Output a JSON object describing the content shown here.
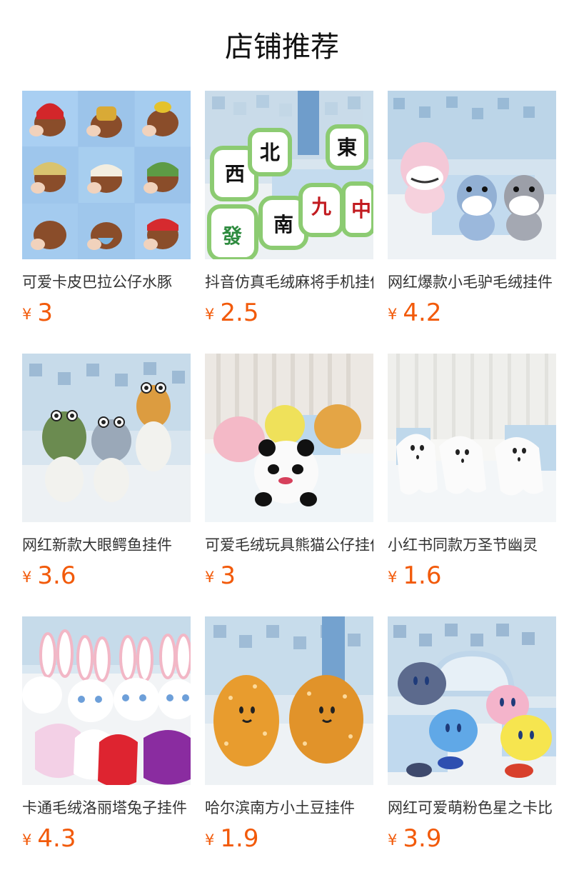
{
  "header": {
    "title": "店铺推荐"
  },
  "accent_color": "#f25a0a",
  "products": [
    {
      "name": "可爱卡皮巴拉公仔水豚",
      "currency": "¥",
      "price": "3",
      "image_icon": "capybara-plush-grid-image"
    },
    {
      "name": "抖音仿真毛绒麻将手机挂件",
      "currency": "¥",
      "price": "2.5",
      "image_icon": "mahjong-plush-image"
    },
    {
      "name": "网红爆款小毛驴毛绒挂件",
      "currency": "¥",
      "price": "4.2",
      "image_icon": "donkey-plush-image"
    },
    {
      "name": "网红新款大眼鳄鱼挂件",
      "currency": "¥",
      "price": "3.6",
      "image_icon": "crocodile-plush-image"
    },
    {
      "name": "可爱毛绒玩具熊猫公仔挂件",
      "currency": "¥",
      "price": "3",
      "image_icon": "panda-plush-image"
    },
    {
      "name": "小红书同款万圣节幽灵",
      "currency": "¥",
      "price": "1.6",
      "image_icon": "ghost-plush-image"
    },
    {
      "name": "卡通毛绒洛丽塔兔子挂件",
      "currency": "¥",
      "price": "4.3",
      "image_icon": "rabbit-plush-image"
    },
    {
      "name": "哈尔滨南方小土豆挂件",
      "currency": "¥",
      "price": "1.9",
      "image_icon": "potato-plush-image"
    },
    {
      "name": "网红可爱萌粉色星之卡比",
      "currency": "¥",
      "price": "3.9",
      "image_icon": "kirby-plush-image"
    }
  ]
}
